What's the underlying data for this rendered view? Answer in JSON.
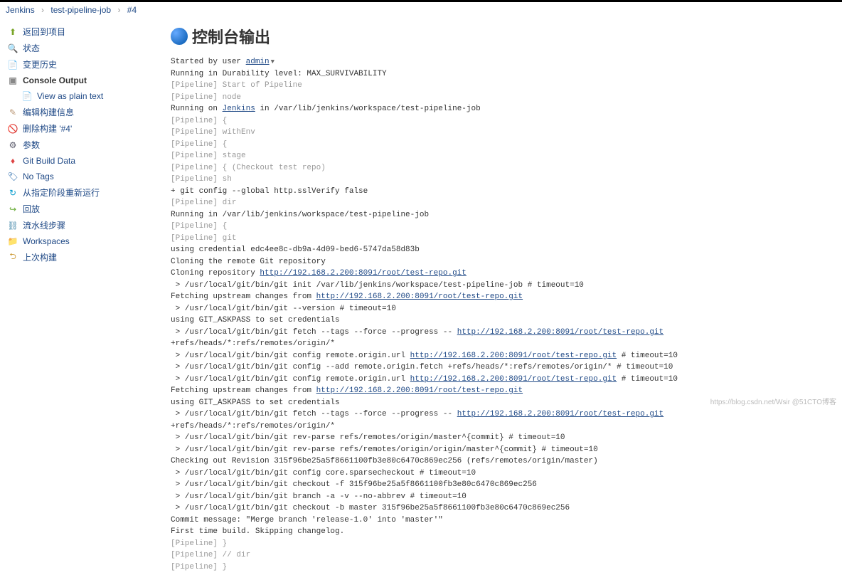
{
  "breadcrumb": {
    "jenkins": "Jenkins",
    "job": "test-pipeline-job",
    "build": "#4"
  },
  "sidebar": {
    "items": [
      {
        "label": "返回到项目"
      },
      {
        "label": "状态"
      },
      {
        "label": "变更历史"
      },
      {
        "label": "Console Output"
      },
      {
        "label": "View as plain text"
      },
      {
        "label": "编辑构建信息"
      },
      {
        "label": "删除构建 '#4'"
      },
      {
        "label": "参数"
      },
      {
        "label": "Git Build Data"
      },
      {
        "label": "No Tags"
      },
      {
        "label": "从指定阶段重新运行"
      },
      {
        "label": "回放"
      },
      {
        "label": "流水线步骤"
      },
      {
        "label": "Workspaces"
      },
      {
        "label": "上次构建"
      }
    ]
  },
  "title": "控制台输出",
  "console": {
    "started": "Started by user ",
    "admin": "admin",
    "durab": "Running in Durability level: MAX_SURVIVABILITY",
    "p_start": "[Pipeline] Start of Pipeline",
    "p_node": "[Pipeline] node",
    "running_on1": "Running on ",
    "jenkins_link": "Jenkins",
    "running_on2": " in /var/lib/jenkins/workspace/test-pipeline-job",
    "p_open": "[Pipeline] {",
    "p_withenv": "[Pipeline] withEnv",
    "p_stage": "[Pipeline] stage",
    "p_checkout": "[Pipeline] { (Checkout test repo)",
    "p_sh": "[Pipeline] sh",
    "gitconfig": "+ git config --global http.sslVerify false",
    "p_dir": "[Pipeline] dir",
    "running_in": "Running in /var/lib/jenkins/workspace/test-pipeline-job",
    "p_git": "[Pipeline] git",
    "cred": "using credential edc4ee8c-db9a-4d09-bed6-5747da58d83b",
    "cloning": "Cloning the remote Git repository",
    "cloning_repo": "Cloning repository ",
    "repo_url": "http://192.168.2.200:8091/root/test-repo.git",
    "git_init": " > /usr/local/git/bin/git init /var/lib/jenkins/workspace/test-pipeline-job # timeout=10",
    "fetch1": "Fetching upstream changes from ",
    "git_ver": " > /usr/local/git/bin/git --version # timeout=10",
    "askpass": "using GIT_ASKPASS to set credentials ",
    "fetch_cmd1": " > /usr/local/git/bin/git fetch --tags --force --progress -- ",
    "fetch_refs": " +refs/heads/*:refs/remotes/origin/*",
    "cfg_url": " > /usr/local/git/bin/git config remote.origin.url ",
    "timeout": " # timeout=10",
    "add_fetch": " > /usr/local/git/bin/git config --add remote.origin.fetch +refs/heads/*:refs/remotes/origin/* # timeout=10",
    "revparse1": " > /usr/local/git/bin/git rev-parse refs/remotes/origin/master^{commit} # timeout=10",
    "revparse2": " > /usr/local/git/bin/git rev-parse refs/remotes/origin/origin/master^{commit} # timeout=10",
    "checkout_rev": "Checking out Revision 315f96be25a5f8661100fb3e80c6470c869ec256 (refs/remotes/origin/master)",
    "sparse": " > /usr/local/git/bin/git config core.sparsecheckout # timeout=10",
    "checkout_f": " > /usr/local/git/bin/git checkout -f 315f96be25a5f8661100fb3e80c6470c869ec256",
    "branch_a": " > /usr/local/git/bin/git branch -a -v --no-abbrev # timeout=10",
    "checkout_b": " > /usr/local/git/bin/git checkout -b master 315f96be25a5f8661100fb3e80c6470c869ec256",
    "commit_msg": "Commit message: \"Merge branch 'release-1.0' into 'master'\"",
    "first_build": "First time build. Skipping changelog.",
    "p_close": "[Pipeline] }",
    "p_dir_end": "[Pipeline] // dir",
    "p_last": "[Pipeline] }"
  },
  "watermark": "https://blog.csdn.net/Wsir @51CTO博客"
}
